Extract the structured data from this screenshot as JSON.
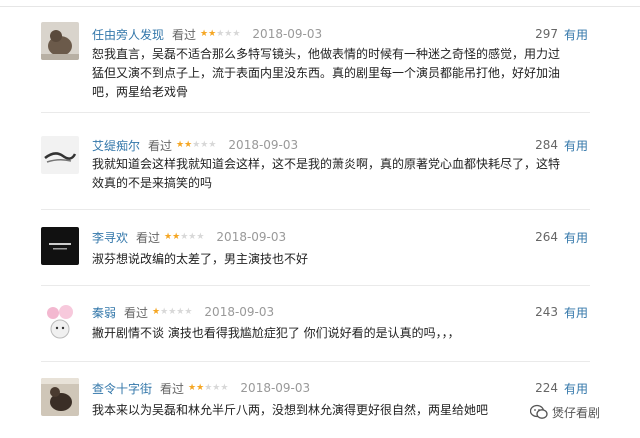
{
  "reviews": [
    {
      "user": "任由旁人发现",
      "watched": "看过",
      "rating": 2,
      "date": "2018-09-03",
      "votes": "297",
      "vote_label": "有用",
      "text": "恕我直言，吴磊不适合那么多特写镜头，他做表情的时候有一种迷之奇怪的感觉，用力过猛但又演不到点子上，流于表面内里没东西。真的剧里每一个演员都能吊打他，好好加油吧，两星给老戏骨"
    },
    {
      "user": "艾缇痴尔",
      "watched": "看过",
      "rating": 2,
      "date": "2018-09-03",
      "votes": "284",
      "vote_label": "有用",
      "text": "我就知道会这样我就知道会这样，这不是我的萧炎啊，真的原著党心血都快耗尽了，这特效真的不是来搞笑的吗"
    },
    {
      "user": "李寻欢",
      "watched": "看过",
      "rating": 2,
      "date": "2018-09-03",
      "votes": "264",
      "vote_label": "有用",
      "text": "淑芬想说改编的太差了，男主演技也不好"
    },
    {
      "user": "秦弱",
      "watched": "看过",
      "rating": 1,
      "date": "2018-09-03",
      "votes": "243",
      "vote_label": "有用",
      "text": "撇开剧情不谈 演技也看得我尴尬症犯了 你们说好看的是认真的吗，，，"
    },
    {
      "user": "查令十字街",
      "watched": "看过",
      "rating": 2,
      "date": "2018-09-03",
      "votes": "224",
      "vote_label": "有用",
      "text": "我本来以为吴磊和林允半斤八两，没想到林允演得更好很自然，两星给她吧"
    }
  ],
  "watermark": {
    "text": "煲仔看剧"
  },
  "colors": {
    "link": "#3377aa",
    "star": "#f5a623",
    "star_empty": "#d8d8d8"
  }
}
